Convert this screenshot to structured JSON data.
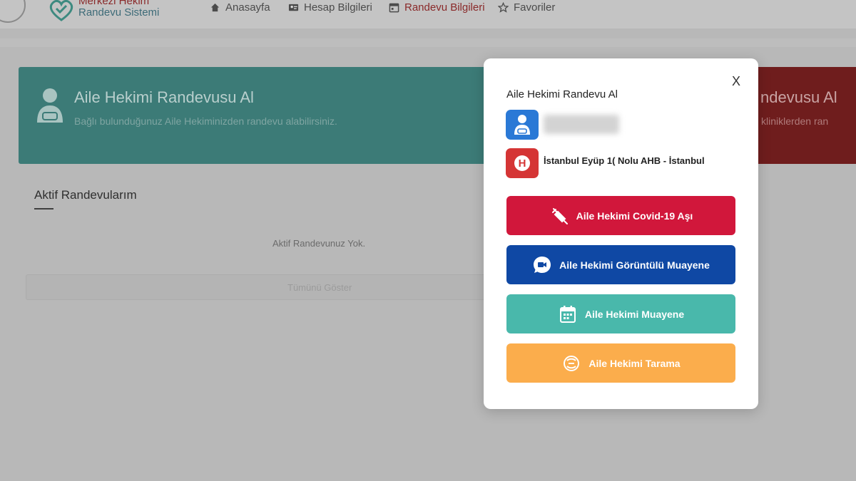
{
  "header": {
    "logo_line1": "Merkezi Hekim",
    "logo_line2": "Randevu Sistemi",
    "nav": [
      {
        "label": "Anasayfa",
        "icon": "home-icon"
      },
      {
        "label": "Hesap Bilgileri",
        "icon": "id-card-icon"
      },
      {
        "label": "Randevu Bilgileri",
        "icon": "calendar-icon",
        "active": true
      },
      {
        "label": "Favoriler",
        "icon": "star-icon"
      }
    ]
  },
  "cards": {
    "family_doctor": {
      "title": "Aile Hekimi Randevusu Al",
      "subtitle": "Bağlı bulunduğunuz Aile Hekiminizden randevu alabilirsiniz.",
      "color": "#3c7b77"
    },
    "hospital": {
      "title_fragment": "ndevusu Al",
      "subtitle_fragment": "unan kliniklerden ran",
      "color": "#6f1d1d"
    }
  },
  "appointments": {
    "title": "Aktif Randevularım",
    "empty_text": "Aktif Randevunuz Yok.",
    "all_button": "Tümünü Göster"
  },
  "modal": {
    "title": "Aile Hekimi Randevu Al",
    "close_label": "X",
    "doctor_icon": "doctor-icon",
    "hospital_icon": "hospital-icon",
    "hospital_badge": "H",
    "hospital_name": "İstanbul Eyüp 1( Nolu AHB - İstanbul",
    "buttons": [
      {
        "label": "Aile Hekimi Covid-19 Aşı",
        "icon": "syringe-icon",
        "color": "#d1173b"
      },
      {
        "label": "Aile Hekimi Görüntülü Muayene",
        "icon": "video-chat-icon",
        "color": "#0f48a4"
      },
      {
        "label": "Aile Hekimi Muayene",
        "icon": "calendar-check-icon",
        "color": "#49b8ab"
      },
      {
        "label": "Aile Hekimi Tarama",
        "icon": "screening-icon",
        "color": "#fbad4c"
      }
    ]
  }
}
